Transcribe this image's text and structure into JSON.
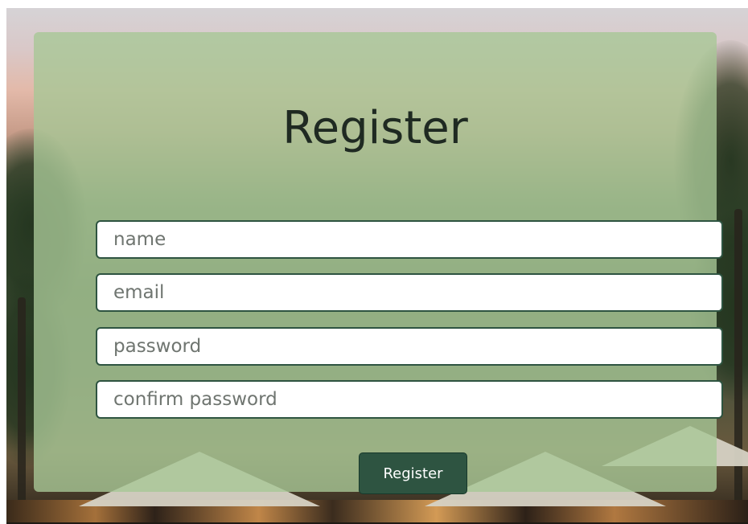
{
  "form": {
    "title": "Register",
    "fields": [
      {
        "name": "name",
        "placeholder": "name",
        "value": ""
      },
      {
        "name": "email",
        "placeholder": "email",
        "value": ""
      },
      {
        "name": "password",
        "placeholder": "password",
        "value": ""
      },
      {
        "name": "confirm_password",
        "placeholder": "confirm password",
        "value": ""
      }
    ],
    "submit_label": "Register"
  },
  "colors": {
    "card_overlay": "#a8c796",
    "button_bg": "#2e5441",
    "field_border": "#2e5441",
    "title_text": "#1f2a22"
  }
}
